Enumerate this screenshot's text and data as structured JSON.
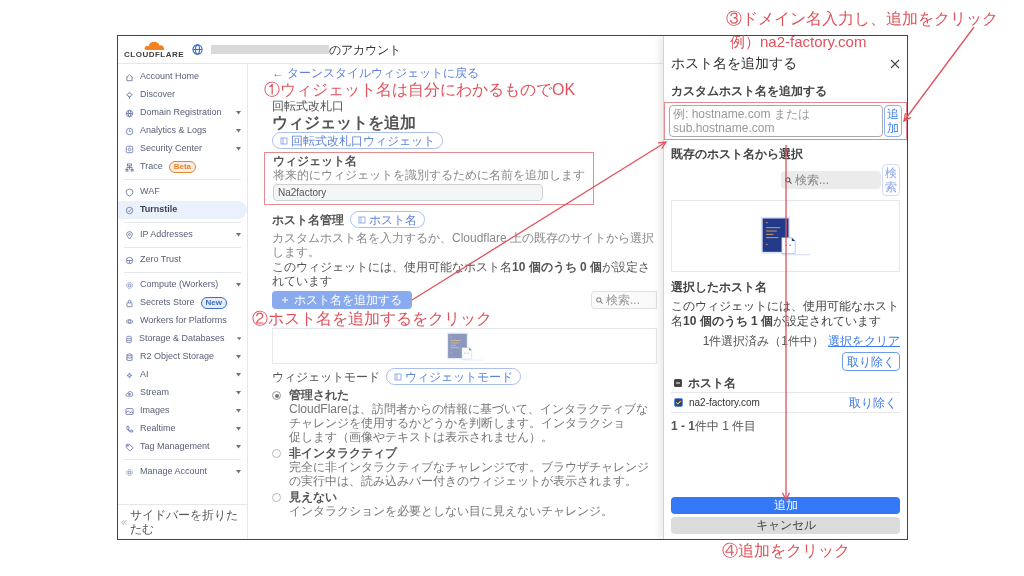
{
  "header": {
    "logo": "CLOUDFLARE",
    "account_suffix": "のアカウント"
  },
  "sidebar": {
    "groups": [
      [
        {
          "label": "Account Home",
          "expandable": false,
          "selected": false
        },
        {
          "label": "Discover",
          "expandable": false,
          "selected": false
        },
        {
          "label": "Domain Registration",
          "expandable": true,
          "selected": false
        },
        {
          "label": "Analytics & Logs",
          "expandable": true,
          "selected": false
        },
        {
          "label": "Security Center",
          "expandable": true,
          "selected": false
        },
        {
          "label": "Trace",
          "expandable": false,
          "selected": false,
          "badge": {
            "text": "Beta",
            "color": "#e8832a"
          }
        }
      ],
      [
        {
          "label": "WAF",
          "expandable": false,
          "selected": false
        },
        {
          "label": "Turnstile",
          "expandable": false,
          "selected": true
        }
      ],
      [
        {
          "label": "IP Addresses",
          "expandable": true,
          "selected": false
        }
      ],
      [
        {
          "label": "Zero Trust",
          "expandable": false,
          "selected": false
        }
      ],
      [
        {
          "label": "Compute (Workers)",
          "expandable": true,
          "selected": false
        },
        {
          "label": "Secrets Store",
          "expandable": false,
          "selected": false,
          "badge": {
            "text": "New",
            "color": "#3b6fc4"
          }
        },
        {
          "label": "Workers for Platforms",
          "expandable": false,
          "selected": false
        },
        {
          "label": "Storage & Databases",
          "expandable": true,
          "selected": false
        },
        {
          "label": "R2 Object Storage",
          "expandable": true,
          "selected": false
        },
        {
          "label": "AI",
          "expandable": true,
          "selected": false
        },
        {
          "label": "Stream",
          "expandable": true,
          "selected": false
        },
        {
          "label": "Images",
          "expandable": true,
          "selected": false
        },
        {
          "label": "Realtime",
          "expandable": true,
          "selected": false
        },
        {
          "label": "Tag Management",
          "expandable": true,
          "selected": false
        }
      ],
      [
        {
          "label": "Manage Account",
          "expandable": true,
          "selected": false
        }
      ]
    ],
    "collapse": "サイドバーを折りたたむ"
  },
  "main": {
    "back_link": "← ターンスタイルウィジェットに戻る",
    "breadcrumb": "回転式改札口",
    "title": "ウィジェットを追加",
    "title_pill": "回転式改札口ウィジェット",
    "widget_name": {
      "label": "ウィジェット名",
      "hint": "将来的にウィジェットを識別するために名前を追加します",
      "value": "Na2factory"
    },
    "hostnames": {
      "label": "ホスト名管理",
      "pill": "ホスト名",
      "description": "カスタムホスト名を入力するか、Cloudflare 上の既存のサイトから選択します。",
      "count_text": "このウィジェットには、使用可能なホスト名**10 個のうち 0 個**が設定されています",
      "add_button": "ホスト名を追加する",
      "search_placeholder": "検索..."
    },
    "mode": {
      "label": "ウィジェットモード",
      "pill": "ウィジェットモード",
      "options": [
        {
          "label": "管理された",
          "description_lines": [
            "CloudFlareは、訪問者からの情報に基づいて、インタラクティブなチャレンジを使用するかどうかを判断します。インタラクショ",
            "促します（画像やテキストは表示されません）。"
          ],
          "selected": true
        },
        {
          "label": "非インタラクティブ",
          "description_lines": [
            "完全に非インタラクティブなチャレンジです。ブラウザチャレンジの実行中は、読み込みバー付きのウィジェットが表示されます。"
          ],
          "selected": false
        },
        {
          "label": "見えない",
          "description_lines": [
            "インタラクションを必要としない目に見えないチャレンジ。"
          ],
          "selected": false
        }
      ]
    }
  },
  "panel": {
    "title": "ホスト名を追加する",
    "custom": {
      "label": "カスタムホスト名を追加する",
      "placeholder": "例: hostname.com または sub.hostname.com",
      "button": "追加"
    },
    "existing": {
      "label": "既存のホスト名から選択",
      "search_placeholder": "検索...",
      "search_button": "検索",
      "search_button_disabled": true
    },
    "selected": {
      "label": "選択したホスト名",
      "count_text": "このウィジェットには、使用可能なホスト名**10 個のうち 1 個**が設定されています",
      "summary": "1件選択済み（1件中）",
      "clear_link": "選択をクリア",
      "remove_button": "取り除く",
      "column": "ホスト名",
      "all_selected": true,
      "rows": [
        {
          "host": "na2-factory.com",
          "checked": true,
          "action": "取り除く"
        }
      ],
      "pagination": "**1 - 1**件中 1 件目"
    },
    "submit": "追加",
    "cancel": "キャンセル"
  },
  "annotations": [
    "①ウィジェット名は自分にわかるものでOK",
    "②ホスト名を追加するをクリック",
    "③ドメイン名入力し、追加をクリック",
    "例）na2-factory.com",
    "④追加をクリック"
  ]
}
